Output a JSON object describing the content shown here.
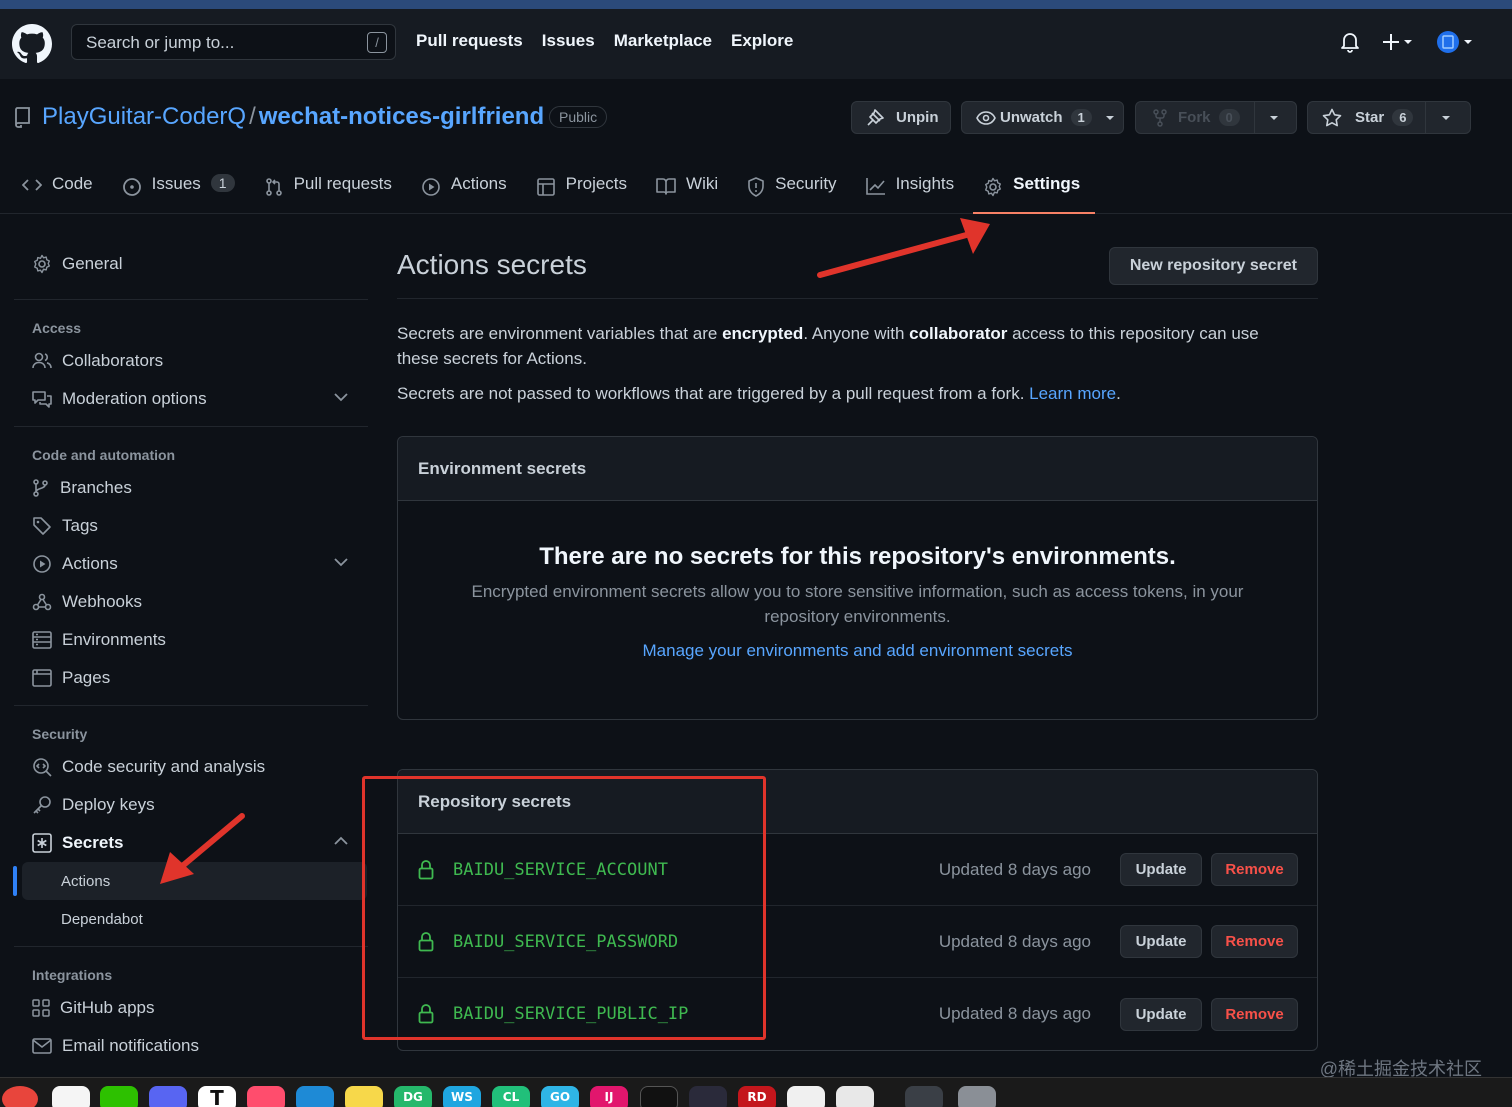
{
  "header": {
    "search_placeholder": "Search or jump to...",
    "search_key": "/",
    "nav": [
      "Pull requests",
      "Issues",
      "Marketplace",
      "Explore"
    ]
  },
  "repo": {
    "owner": "PlayGuitar-CoderQ",
    "separator": "/",
    "name": "wechat-notices-girlfriend",
    "visibility": "Public",
    "unpin_label": "Unpin",
    "watch_label": "Unwatch",
    "watch_count": "1",
    "fork_label": "Fork",
    "fork_count": "0",
    "star_label": "Star",
    "star_count": "6"
  },
  "tabs": {
    "code": "Code",
    "issues": "Issues",
    "issues_count": "1",
    "pulls": "Pull requests",
    "actions": "Actions",
    "projects": "Projects",
    "wiki": "Wiki",
    "security": "Security",
    "insights": "Insights",
    "settings": "Settings"
  },
  "sidebar": {
    "general": "General",
    "access_heading": "Access",
    "collaborators": "Collaborators",
    "moderation": "Moderation options",
    "code_heading": "Code and automation",
    "branches": "Branches",
    "tags": "Tags",
    "actions": "Actions",
    "webhooks": "Webhooks",
    "environments": "Environments",
    "pages": "Pages",
    "security_heading": "Security",
    "code_security": "Code security and analysis",
    "deploy_keys": "Deploy keys",
    "secrets": "Secrets",
    "secrets_actions": "Actions",
    "secrets_dependabot": "Dependabot",
    "integrations_heading": "Integrations",
    "github_apps": "GitHub apps",
    "email": "Email notifications"
  },
  "main": {
    "title": "Actions secrets",
    "new_secret_button": "New repository secret",
    "desc1_a": "Secrets are environment variables that are ",
    "desc1_b": "encrypted",
    "desc1_c": ". Anyone with ",
    "desc1_d": "collaborator",
    "desc1_e": " access to this repository can use these secrets for Actions.",
    "desc2_a": "Secrets are not passed to workflows that are triggered by a pull request from a fork. ",
    "desc2_link": "Learn more",
    "desc2_end": ".",
    "env": {
      "heading": "Environment secrets",
      "empty_title": "There are no secrets for this repository's environments.",
      "empty_desc": "Encrypted environment secrets allow you to store sensitive information, such as access tokens, in your repository environments.",
      "manage_link": "Manage your environments and add environment secrets"
    },
    "repo_secrets": {
      "heading": "Repository secrets",
      "items": [
        {
          "name": "BAIDU_SERVICE_ACCOUNT",
          "updated": "Updated 8 days ago",
          "update": "Update",
          "remove": "Remove"
        },
        {
          "name": "BAIDU_SERVICE_PASSWORD",
          "updated": "Updated 8 days ago",
          "update": "Update",
          "remove": "Remove"
        },
        {
          "name": "BAIDU_SERVICE_PUBLIC_IP",
          "updated": "Updated 8 days ago",
          "update": "Update",
          "remove": "Remove"
        }
      ]
    }
  },
  "watermark": "@稀土掘金技术社区",
  "dock": [
    "DG",
    "WS",
    "CL",
    "GO",
    "IJ",
    "T",
    "RD"
  ],
  "colors": {
    "link": "#58a6ff",
    "secret_name": "#3fb950",
    "remove": "#f85149",
    "annotation": "#e0342b",
    "selected_tab": "#f78166"
  }
}
